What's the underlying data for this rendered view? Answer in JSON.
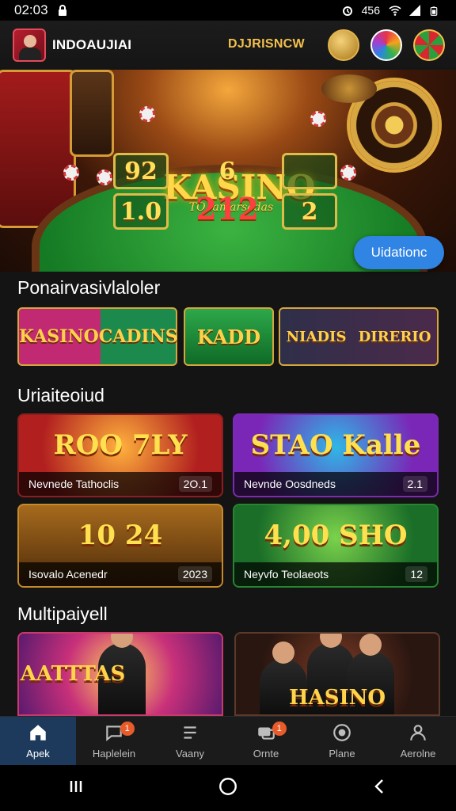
{
  "status_bar": {
    "time": "02:03",
    "signal_text": "4̈56"
  },
  "header": {
    "brand": "INDOAUJIAI",
    "promo_title": "DJJRISNCW",
    "coins": [
      "gold-badge",
      "rainbow-badge",
      "roulette-badge"
    ]
  },
  "hero": {
    "title": "KASINO",
    "subtitle": "TO lamarsadas",
    "tiles": [
      "92",
      "6",
      "1.0",
      "212",
      "2"
    ],
    "update_button": "Uidationc"
  },
  "sections": {
    "promos_title": "Ponairvasivlaloler",
    "games_title": "Uriaiteoiud",
    "multi_title": "Multipaiyell"
  },
  "promos": [
    {
      "left": "KASINO",
      "right": "CADINS"
    },
    {
      "label": "KADD"
    },
    {
      "left": "NIADIS",
      "right": "DIRERIO"
    }
  ],
  "games": [
    {
      "art": "ROO 7LY",
      "name": "Nevnede Tathoclis",
      "count": "2O.1"
    },
    {
      "art": "STAO Kalle",
      "name": "Nevnde Oosdneds",
      "count": "2.1"
    },
    {
      "art": "10 24",
      "name": "Isovalo Acenedr",
      "count": "2023"
    },
    {
      "art": "4,00 SHO",
      "name": "Neyvfo Teolaeots",
      "count": "12"
    }
  ],
  "multi": [
    {
      "label": "AATTTAS"
    },
    {
      "label": "HASINO"
    }
  ],
  "bottom_nav": [
    {
      "label": "Apek",
      "icon": "home-icon",
      "active": true,
      "badge": ""
    },
    {
      "label": "Haplelein",
      "icon": "chat-icon",
      "active": false,
      "badge": "1"
    },
    {
      "label": "Vaany",
      "icon": "list-icon",
      "active": false,
      "badge": ""
    },
    {
      "label": "Ornte",
      "icon": "message-icon",
      "active": false,
      "badge": "1"
    },
    {
      "label": "Plane",
      "icon": "support-icon",
      "active": false,
      "badge": ""
    },
    {
      "label": "Aerolne",
      "icon": "profile-icon",
      "active": false,
      "badge": ""
    }
  ],
  "colors": {
    "accent": "#2f84e4",
    "gold": "#ffd84a",
    "nav_active": "#1d3a5c"
  }
}
